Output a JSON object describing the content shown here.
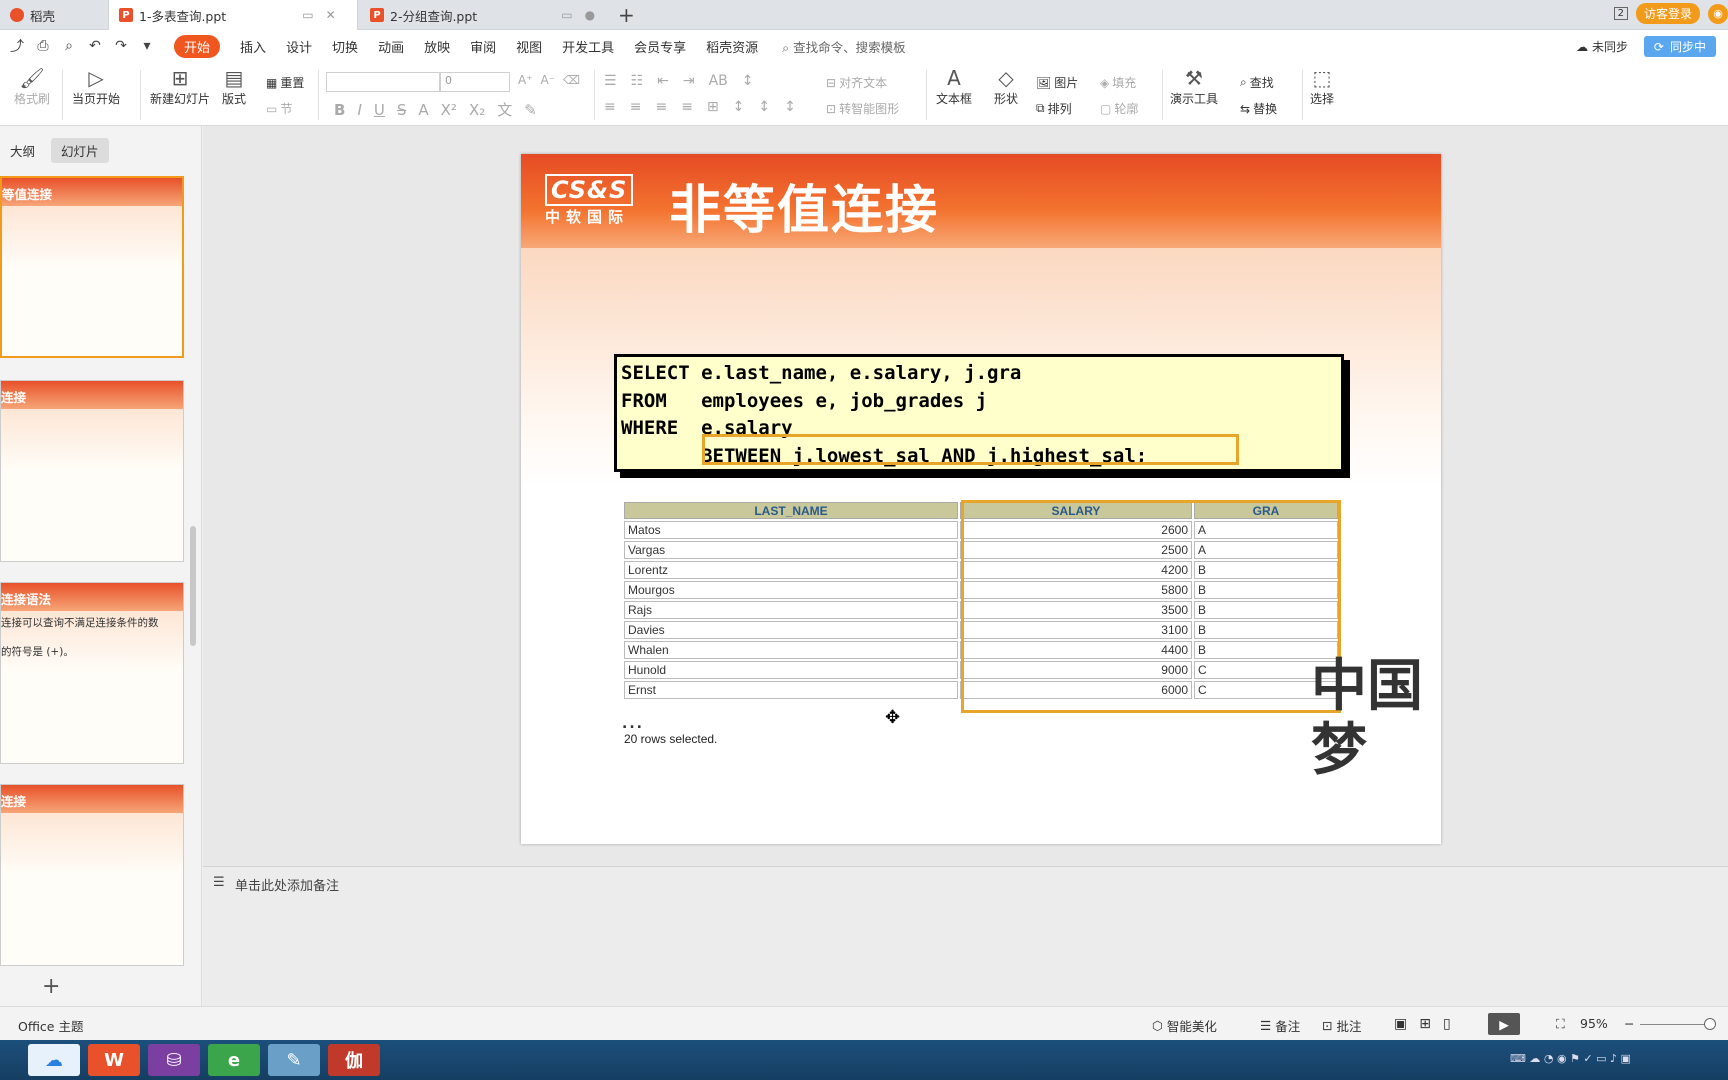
{
  "tabs": {
    "home": "稻壳",
    "tab1": "1-多表查询.ppt",
    "tab2": "2-分组查询.ppt",
    "new_tab": "+"
  },
  "top_right": {
    "badge": "2",
    "visitor_login": "访客登录",
    "sync": "同步中",
    "cloud": "未同步"
  },
  "menu": {
    "items": [
      "开始",
      "插入",
      "设计",
      "切换",
      "动画",
      "放映",
      "审阅",
      "视图",
      "开发工具",
      "会员专享",
      "稻壳资源"
    ],
    "search": "查找命令、搜索模板"
  },
  "ribbon": {
    "format_painter": "格式刷",
    "play_from_current": "当页开始",
    "new_slide": "新建幻灯片",
    "layout": "版式",
    "reset": "重置",
    "section": "节",
    "font_size": "0",
    "align_text": "对齐文本",
    "smart_art": "转智能图形",
    "textbox": "文本框",
    "shape": "形状",
    "picture": "图片",
    "arrange": "排列",
    "fill": "填充",
    "outline": "轮廓",
    "presenter_tools": "演示工具",
    "find": "查找",
    "replace": "替换",
    "select": "选择"
  },
  "left_panel": {
    "tab_outline": "大纲",
    "tab_slides": "幻灯片",
    "thumbs": [
      {
        "title": "等值连接"
      },
      {
        "title": "连接"
      },
      {
        "title": "连接语法",
        "text1": "连接可以查询不满足连接条件的数",
        "text2": "的符号是 (+)。"
      },
      {
        "title": "连接"
      }
    ],
    "add": "+"
  },
  "slide": {
    "logo_top": "CS&S",
    "logo_bottom": "中软国际",
    "title": "非等值连接",
    "code_lines": [
      "SELECT e.last_name, e.salary, j.gra",
      "FROM   employees e, job_grades j",
      "WHERE  e.salary",
      "       BETWEEN j.lowest_sal AND j.highest_sal;"
    ],
    "table": {
      "headers": [
        "LAST_NAME",
        "SALARY",
        "GRA"
      ],
      "rows": [
        [
          "Matos",
          "2600",
          "A"
        ],
        [
          "Vargas",
          "2500",
          "A"
        ],
        [
          "Lorentz",
          "4200",
          "B"
        ],
        [
          "Mourgos",
          "5800",
          "B"
        ],
        [
          "Rajs",
          "3500",
          "B"
        ],
        [
          "Davies",
          "3100",
          "B"
        ],
        [
          "Whalen",
          "4400",
          "B"
        ],
        [
          "Hunold",
          "9000",
          "C"
        ],
        [
          "Ernst",
          "6000",
          "C"
        ]
      ]
    },
    "ellipsis": "...",
    "rows_selected": "20 rows selected.",
    "calligraphy": "中国梦"
  },
  "notes": {
    "placeholder": "单击此处添加备注"
  },
  "status": {
    "theme": "Office 主题",
    "beautify": "智能美化",
    "notes": "备注",
    "comments": "批注",
    "zoom": "95%"
  },
  "colors": {
    "accent": "#f0561e",
    "highlight": "#e9a42a",
    "code_bg": "#ffffcc"
  }
}
